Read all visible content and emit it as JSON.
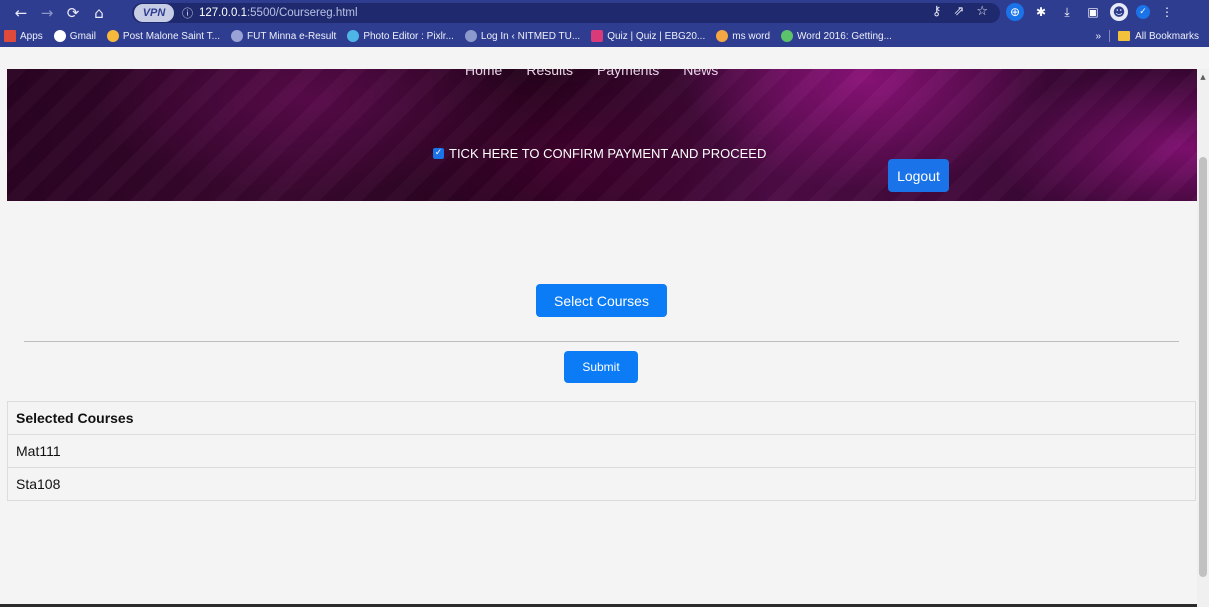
{
  "browser": {
    "url_host": "127.0.0.1",
    "url_path": ":5500/Coursereg.html",
    "vpn_label": "VPN",
    "bookmarks": [
      {
        "label": "Apps",
        "color": "#e04a3a"
      },
      {
        "label": "Gmail",
        "color": "#ffffff"
      },
      {
        "label": "Post Malone Saint T...",
        "color": "#f6b93b"
      },
      {
        "label": "FUT Minna e-Result",
        "color": "#9aa3d6"
      },
      {
        "label": "Photo Editor : Pixlr...",
        "color": "#4db6e6"
      },
      {
        "label": "Log In ‹ NITMED TU...",
        "color": "#8c99cc"
      },
      {
        "label": "Quiz | Quiz | EBG20...",
        "color": "#d93a7a"
      },
      {
        "label": "ms word",
        "color": "#f4a742"
      },
      {
        "label": "Word 2016: Getting...",
        "color": "#5cc36b"
      }
    ],
    "more_bookmarks": "»",
    "all_bookmarks": "All Bookmarks"
  },
  "header": {
    "nav": [
      "Home",
      "Results",
      "Payments",
      "News"
    ],
    "confirm_label": "TICK HERE TO CONFIRM PAYMENT AND PROCEED",
    "logout_label": "Logout"
  },
  "main": {
    "select_label": "Select Courses",
    "submit_label": "Submit",
    "table": {
      "header": "Selected Courses",
      "rows": [
        "Mat111",
        "Sta108"
      ]
    }
  },
  "colors": {
    "primary": "#0b7cf5",
    "chrome": "#2f3d90"
  }
}
